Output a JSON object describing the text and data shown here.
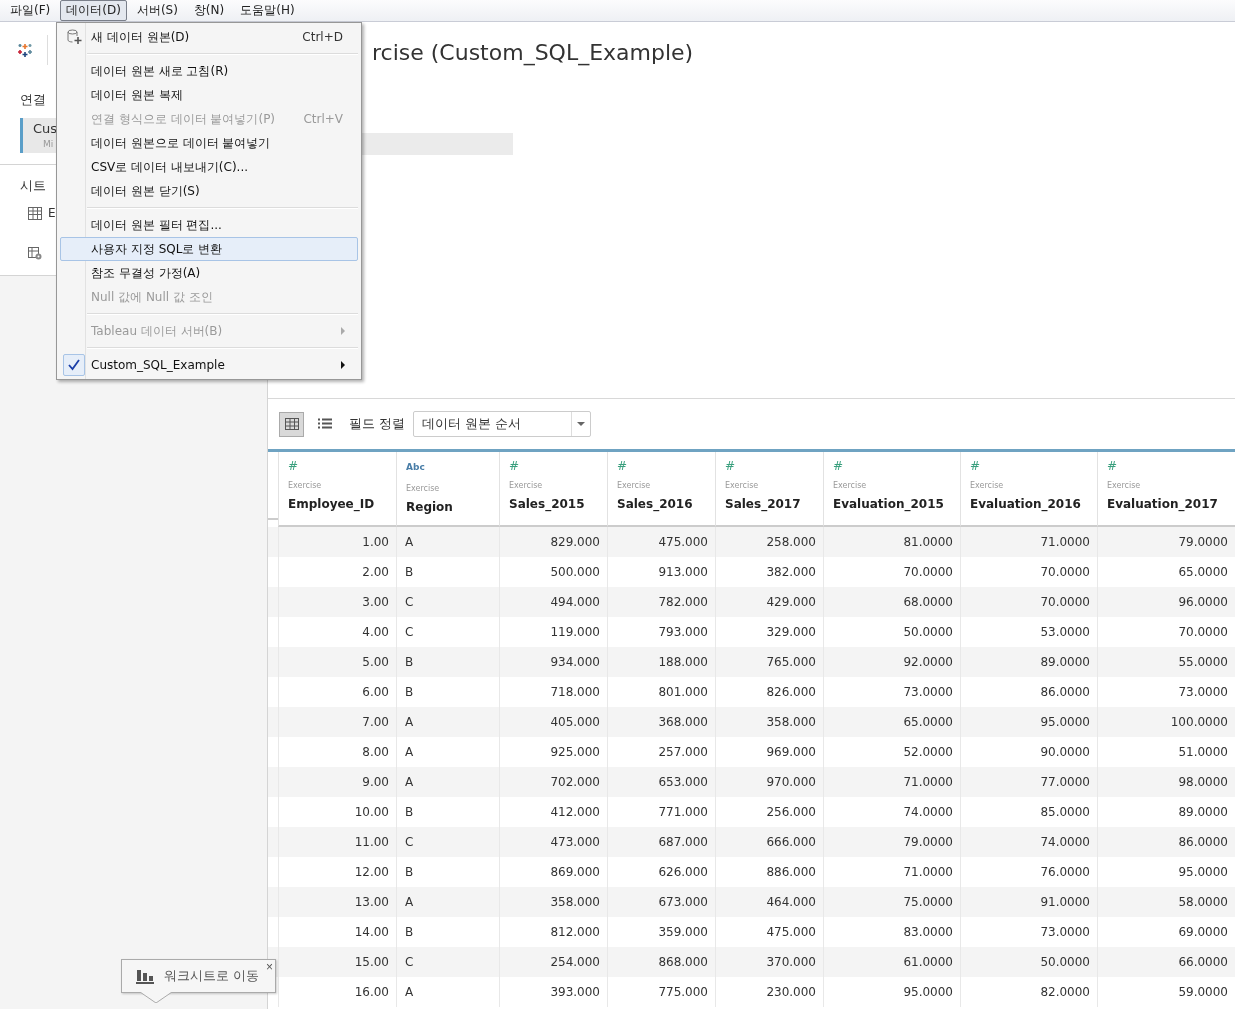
{
  "menubar": [
    {
      "label": "파일(F)",
      "selected": false
    },
    {
      "label": "데이터(D)",
      "selected": true
    },
    {
      "label": "서버(S)",
      "selected": false
    },
    {
      "label": "창(N)",
      "selected": false
    },
    {
      "label": "도움말(H)",
      "selected": false
    }
  ],
  "sidebar": {
    "connections_heading": "연결",
    "connection": {
      "name": "Cus",
      "detail": "Mi"
    },
    "sheets_heading": "시트",
    "sheets": [
      {
        "kind": "table",
        "label": "E"
      },
      {
        "kind": "custom-sql"
      }
    ]
  },
  "title": "rcise (Custom_SQL_Example)",
  "toolbar": {
    "views": [
      {
        "kind": "grid",
        "selected": true
      },
      {
        "kind": "list",
        "selected": false
      }
    ],
    "sort_label": "필드 정렬",
    "sort_value": "데이터 원본 순서"
  },
  "table": {
    "columns": [
      {
        "type_icon": "#",
        "source": "Exercise",
        "name": "Employee_ID",
        "kind": "number"
      },
      {
        "type_icon": "Abc",
        "source": "Exercise",
        "name": "Region",
        "kind": "text"
      },
      {
        "type_icon": "#",
        "source": "Exercise",
        "name": "Sales_2015",
        "kind": "number"
      },
      {
        "type_icon": "#",
        "source": "Exercise",
        "name": "Sales_2016",
        "kind": "number"
      },
      {
        "type_icon": "#",
        "source": "Exercise",
        "name": "Sales_2017",
        "kind": "number"
      },
      {
        "type_icon": "#",
        "source": "Exercise",
        "name": "Evaluation_2015",
        "kind": "number"
      },
      {
        "type_icon": "#",
        "source": "Exercise",
        "name": "Evaluation_2016",
        "kind": "number"
      },
      {
        "type_icon": "#",
        "source": "Exercise",
        "name": "Evaluation_2017",
        "kind": "number"
      }
    ],
    "rows": [
      [
        "1.00",
        "A",
        "829.000",
        "475.000",
        "258.000",
        "81.0000",
        "71.0000",
        "79.0000"
      ],
      [
        "2.00",
        "B",
        "500.000",
        "913.000",
        "382.000",
        "70.0000",
        "70.0000",
        "65.0000"
      ],
      [
        "3.00",
        "C",
        "494.000",
        "782.000",
        "429.000",
        "68.0000",
        "70.0000",
        "96.0000"
      ],
      [
        "4.00",
        "C",
        "119.000",
        "793.000",
        "329.000",
        "50.0000",
        "53.0000",
        "70.0000"
      ],
      [
        "5.00",
        "B",
        "934.000",
        "188.000",
        "765.000",
        "92.0000",
        "89.0000",
        "55.0000"
      ],
      [
        "6.00",
        "B",
        "718.000",
        "801.000",
        "826.000",
        "73.0000",
        "86.0000",
        "73.0000"
      ],
      [
        "7.00",
        "A",
        "405.000",
        "368.000",
        "358.000",
        "65.0000",
        "95.0000",
        "100.0000"
      ],
      [
        "8.00",
        "A",
        "925.000",
        "257.000",
        "969.000",
        "52.0000",
        "90.0000",
        "51.0000"
      ],
      [
        "9.00",
        "A",
        "702.000",
        "653.000",
        "970.000",
        "71.0000",
        "77.0000",
        "98.0000"
      ],
      [
        "10.00",
        "B",
        "412.000",
        "771.000",
        "256.000",
        "74.0000",
        "85.0000",
        "89.0000"
      ],
      [
        "11.00",
        "C",
        "473.000",
        "687.000",
        "666.000",
        "79.0000",
        "74.0000",
        "86.0000"
      ],
      [
        "12.00",
        "B",
        "869.000",
        "626.000",
        "886.000",
        "71.0000",
        "76.0000",
        "95.0000"
      ],
      [
        "13.00",
        "A",
        "358.000",
        "673.000",
        "464.000",
        "75.0000",
        "91.0000",
        "58.0000"
      ],
      [
        "14.00",
        "B",
        "812.000",
        "359.000",
        "475.000",
        "83.0000",
        "73.0000",
        "69.0000"
      ],
      [
        "15.00",
        "C",
        "254.000",
        "868.000",
        "370.000",
        "61.0000",
        "50.0000",
        "66.0000"
      ],
      [
        "16.00",
        "A",
        "393.000",
        "775.000",
        "230.000",
        "95.0000",
        "82.0000",
        "59.0000"
      ]
    ]
  },
  "menu": [
    {
      "kind": "item",
      "label": "새 데이터 원본(D)",
      "shortcut": "Ctrl+D",
      "disabled": false,
      "selected": false
    },
    {
      "kind": "separator"
    },
    {
      "kind": "item",
      "label": "데이터 원본 새로 고침(R)",
      "disabled": false,
      "selected": false
    },
    {
      "kind": "item",
      "label": "데이터 원본 복제",
      "disabled": false,
      "selected": false
    },
    {
      "kind": "item",
      "label": "연결 형식으로 데이터 붙여넣기(P)",
      "shortcut": "Ctrl+V",
      "disabled": true,
      "selected": false
    },
    {
      "kind": "item",
      "label": "데이터 원본으로 데이터 붙여넣기",
      "disabled": false,
      "selected": false
    },
    {
      "kind": "item",
      "label": "CSV로 데이터 내보내기(C)...",
      "disabled": false,
      "selected": false
    },
    {
      "kind": "item",
      "label": "데이터 원본 닫기(S)",
      "disabled": false,
      "selected": false
    },
    {
      "kind": "separator"
    },
    {
      "kind": "item",
      "label": "데이터 원본 필터 편집...",
      "disabled": false,
      "selected": false
    },
    {
      "kind": "item",
      "label": "사용자 지정 SQL로 변환",
      "disabled": false,
      "selected": true
    },
    {
      "kind": "item",
      "label": "참조 무결성 가정(A)",
      "disabled": false,
      "selected": false
    },
    {
      "kind": "item",
      "label": "Null 값에 Null 값 조인",
      "disabled": true,
      "selected": false
    },
    {
      "kind": "separator"
    },
    {
      "kind": "item",
      "label": "Tableau 데이터 서버(B)",
      "disabled": true,
      "selected": false,
      "submenu": true
    },
    {
      "kind": "separator"
    },
    {
      "kind": "item",
      "label": "Custom_SQL_Example",
      "disabled": false,
      "selected": false,
      "checked": true,
      "submenu": true
    }
  ],
  "tooltip": {
    "label": "워크시트로 이동",
    "close": "×"
  }
}
